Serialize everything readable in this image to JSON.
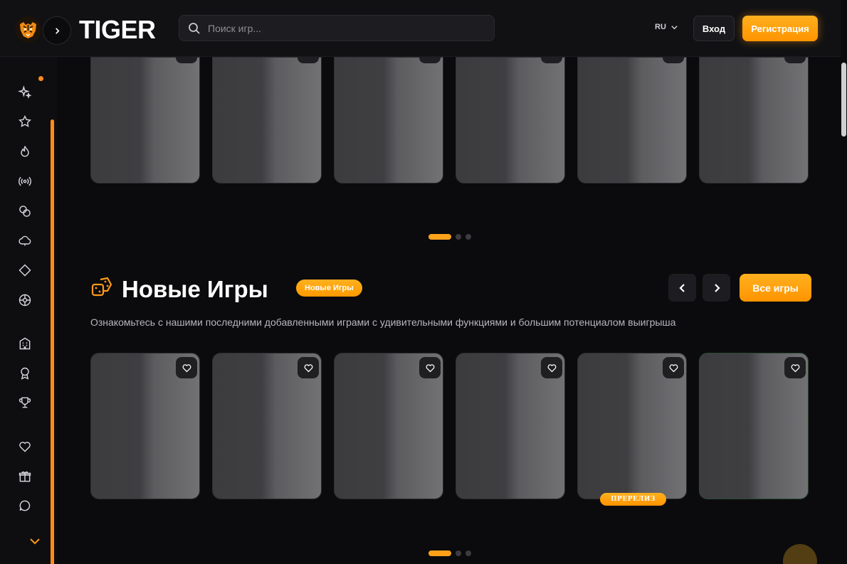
{
  "header": {
    "brand": "TIGER",
    "search": {
      "placeholder": "Поиск игр..."
    },
    "language": "RU",
    "login_label": "Вход",
    "register_label": "Регистрация"
  },
  "sidebar": {
    "icons": [
      "sparkles-icon",
      "star-icon",
      "fire-icon",
      "live-broadcast-icon",
      "coins-icon",
      "cloud-icon",
      "diamond-icon",
      "roulette-icon",
      "building-icon",
      "award-ribbon-icon",
      "trophy-icon",
      "heart-icon",
      "gift-icon",
      "chat-icon"
    ],
    "accent": "#ff8c1a"
  },
  "top_carousel": {
    "card_count": 6,
    "pagination": {
      "pages": 3,
      "active": 1
    }
  },
  "new_games": {
    "title": "Новые Игры",
    "badge": "Новые Игры",
    "all_label": "Все игры",
    "description": "Ознакомьтесь с нашими последними добавленными играми с удивительными функциями и большим потенциалом выигрыша",
    "cards": [
      {
        "tag": ""
      },
      {
        "tag": ""
      },
      {
        "tag": ""
      },
      {
        "tag": ""
      },
      {
        "tag": "ПРЕРЕЛИЗ"
      },
      {
        "tag": ""
      }
    ],
    "pagination": {
      "pages": 3,
      "active": 1
    }
  },
  "colors": {
    "accent": "#ffa21a",
    "background": "#0b0b0d",
    "header": "#111113"
  }
}
